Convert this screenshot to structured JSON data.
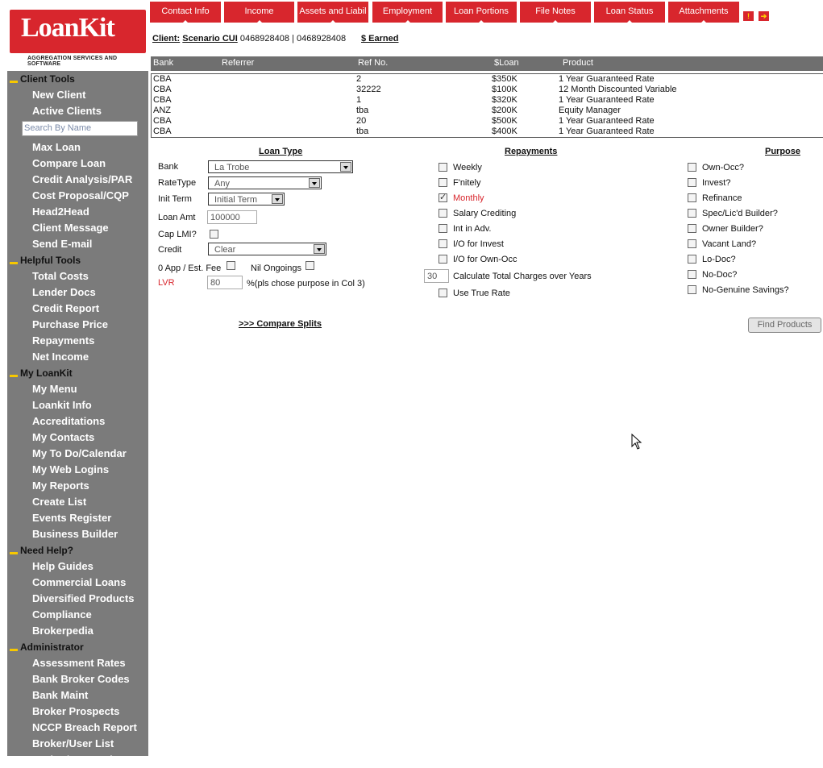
{
  "logo": {
    "name": "LoanKit",
    "tagline": "AGGREGATION SERVICES AND SOFTWARE"
  },
  "tabs": [
    {
      "label": "Contact Info"
    },
    {
      "label": "Income"
    },
    {
      "label": "Assets and Liabil"
    },
    {
      "label": "Employment"
    },
    {
      "label": "Loan Portions"
    },
    {
      "label": "File Notes"
    },
    {
      "label": "Loan Status"
    },
    {
      "label": "Attachments"
    }
  ],
  "client": {
    "prefix": "Client:",
    "name": "Scenario CUI",
    "phones": "0468928408 | 0468928408",
    "earned": "$ Earned"
  },
  "table": {
    "headers": {
      "bank": "Bank",
      "referrer": "Referrer",
      "ref_no": "Ref No.",
      "loan": "$Loan",
      "product": "Product"
    },
    "rows": [
      {
        "bank": "CBA",
        "referrer": "",
        "ref_no": "2",
        "loan": "$350K",
        "product": "1 Year Guaranteed Rate"
      },
      {
        "bank": "CBA",
        "referrer": "",
        "ref_no": "32222",
        "loan": "$100K",
        "product": "12 Month Discounted Variable"
      },
      {
        "bank": "CBA",
        "referrer": "",
        "ref_no": "1",
        "loan": "$320K",
        "product": "1 Year Guaranteed Rate"
      },
      {
        "bank": "ANZ",
        "referrer": "",
        "ref_no": "tba",
        "loan": "$200K",
        "product": "Equity Manager"
      },
      {
        "bank": "CBA",
        "referrer": "",
        "ref_no": "20",
        "loan": "$500K",
        "product": "1 Year Guaranteed Rate"
      },
      {
        "bank": "CBA",
        "referrer": "",
        "ref_no": "tba",
        "loan": "$400K",
        "product": "1 Year Guaranteed Rate"
      }
    ]
  },
  "sidebar": {
    "search_placeholder": "Search By Name",
    "client_tools": {
      "title": "Client Tools",
      "items_top": [
        "New Client",
        "Active Clients"
      ],
      "items": [
        "Max Loan",
        "Compare Loan",
        "Credit Analysis/PAR",
        "Cost Proposal/CQP",
        "Head2Head",
        "Client Message",
        "Send E-mail"
      ]
    },
    "helpful_tools": {
      "title": "Helpful Tools",
      "items": [
        "Total Costs",
        "Lender Docs",
        "Credit Report",
        "Purchase Price",
        "Repayments",
        "Net Income"
      ]
    },
    "my_loankit": {
      "title": "My LoanKit",
      "items": [
        "My Menu",
        "Loankit Info",
        "Accreditations",
        "My Contacts",
        "My To Do/Calendar",
        "My Web Logins",
        "My Reports",
        "Create List",
        "Events Register",
        "Business Builder"
      ]
    },
    "need_help": {
      "title": "Need Help?",
      "items": [
        "Help Guides",
        "Commercial Loans",
        "Diversified Products",
        "Compliance",
        "Brokerpedia"
      ]
    },
    "administrator": {
      "title": "Administrator",
      "items": [
        "Assessment Rates",
        "Bank Broker Codes",
        "Bank Maint",
        "Broker Prospects",
        "NCCP Breach Report",
        "Broker/User List",
        "Broker/User Maint"
      ]
    }
  },
  "loan_type": {
    "heading": "Loan Type",
    "bank_label": "Bank",
    "bank_value": "La Trobe",
    "ratetype_label": "RateType",
    "ratetype_value": "Any",
    "initterm_label": "Init Term",
    "initterm_value": "Initial Term",
    "loanamt_label": "Loan Amt",
    "loanamt_value": "100000",
    "caplmi_label": "Cap LMI?",
    "credit_label": "Credit",
    "credit_value": "Clear",
    "appfee_label": "0 App / Est. Fee",
    "nilongoing_label": "Nil Ongoings",
    "lvr_label": "LVR",
    "lvr_value": "80",
    "lvr_note": "%(pls chose purpose in Col 3)"
  },
  "repayments": {
    "heading": "Repayments",
    "options": [
      {
        "label": "Weekly",
        "checked": false
      },
      {
        "label": "F'nitely",
        "checked": false
      },
      {
        "label": "Monthly",
        "checked": true
      },
      {
        "label": "Salary Crediting",
        "checked": false
      },
      {
        "label": "Int in Adv.",
        "checked": false
      },
      {
        "label": "I/O for Invest",
        "checked": false
      },
      {
        "label": "I/O for Own-Occ",
        "checked": false
      }
    ],
    "years_value": "30",
    "years_label": "Calculate Total Charges over Years",
    "truerate_label": "Use True Rate"
  },
  "purpose": {
    "heading": "Purpose",
    "options": [
      "Own-Occ?",
      "Invest?",
      "Refinance",
      "Spec/Lic'd Builder?",
      "Owner Builder?",
      "Vacant Land?",
      "Lo-Doc?",
      "No-Doc?",
      "No-Genuine Savings?"
    ]
  },
  "actions": {
    "compare_splits": ">>> Compare Splits",
    "find_products": "Find Products"
  },
  "colors": {
    "brand_red": "#d8262d",
    "sidebar_grey": "#7b7b7b",
    "header_grey": "#6f6f6f",
    "accent_yellow": "#f7c800"
  }
}
